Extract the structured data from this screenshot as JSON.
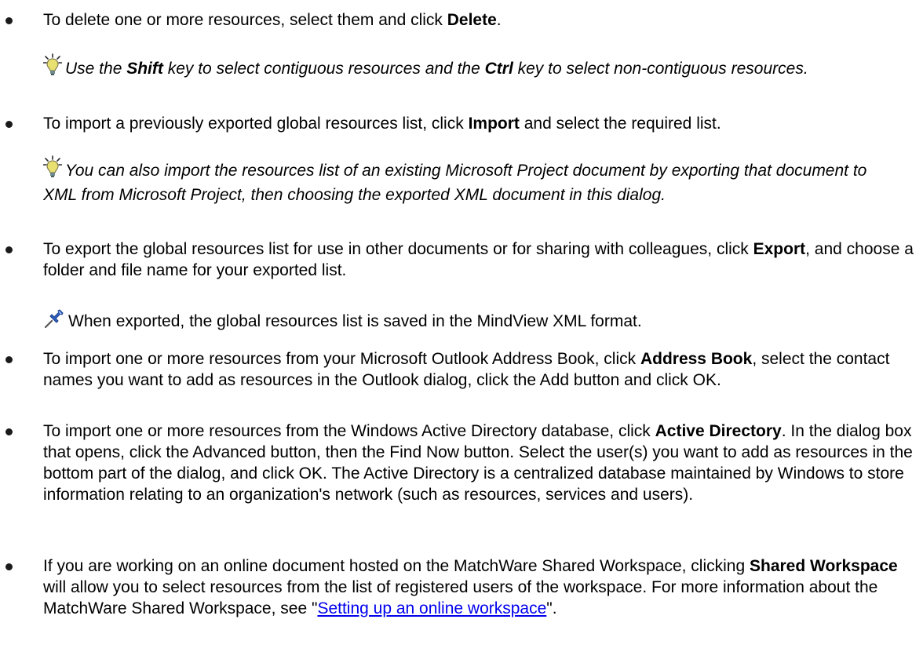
{
  "icons": {
    "tip": "lightbulb-icon",
    "note": "pushpin-icon"
  },
  "colors": {
    "link": "#0000EE",
    "bullet": "#1A1A1A",
    "bulb": "#E8E070"
  },
  "items": [
    {
      "before": "To delete one or more resources, select them and click ",
      "bold": "Delete",
      "after": "."
    },
    {
      "before": "To import a previously exported global resources list, click ",
      "bold": "Import",
      "after": " and select the required list."
    },
    {
      "before": "To export the global resources list for use in other documents or for sharing with colleagues, click ",
      "bold": "Export",
      "after": ", and choose a folder and file name for your exported list."
    },
    {
      "before": "To import one or more resources from your Microsoft Outlook Address Book, click ",
      "bold": "Address Book",
      "after": ", select the contact names you want to add as resources in the Outlook dialog, click the Add button and click OK."
    },
    {
      "before": "To import one or more resources from the Windows Active Directory database, click ",
      "bold": "Active Directory",
      "after": ". In the dialog box that opens, click the Advanced button, then the Find Now button. Select the user(s) you want to add as resources in the bottom part of the dialog, and click OK. The Active Directory is a centralized database maintained by Windows to store information relating to an organization's network (such as resources, services and users)."
    },
    {
      "before": "If you are working on an online document hosted on the MatchWare Shared Workspace, clicking ",
      "bold": "Shared Workspace",
      "after": " will allow you to select resources from the list of registered users of the workspace. For more information about the MatchWare Shared Workspace, see \"",
      "link": "Setting up an online workspace",
      "after2": "\"."
    }
  ],
  "tips": {
    "shift_ctrl": {
      "t1": "Use the ",
      "b1": "Shift",
      "t2": " key to select contiguous resources and the ",
      "b2": "Ctrl",
      "t3": " key to select non-contiguous resources."
    },
    "msproject": {
      "text": "You can also import the resources list of an existing Microsoft Project document by exporting that document to XML from Microsoft Project, then choosing the exported XML document in this dialog."
    },
    "export_note": {
      "text": "When exported, the global resources list is saved in the MindView XML format."
    }
  }
}
